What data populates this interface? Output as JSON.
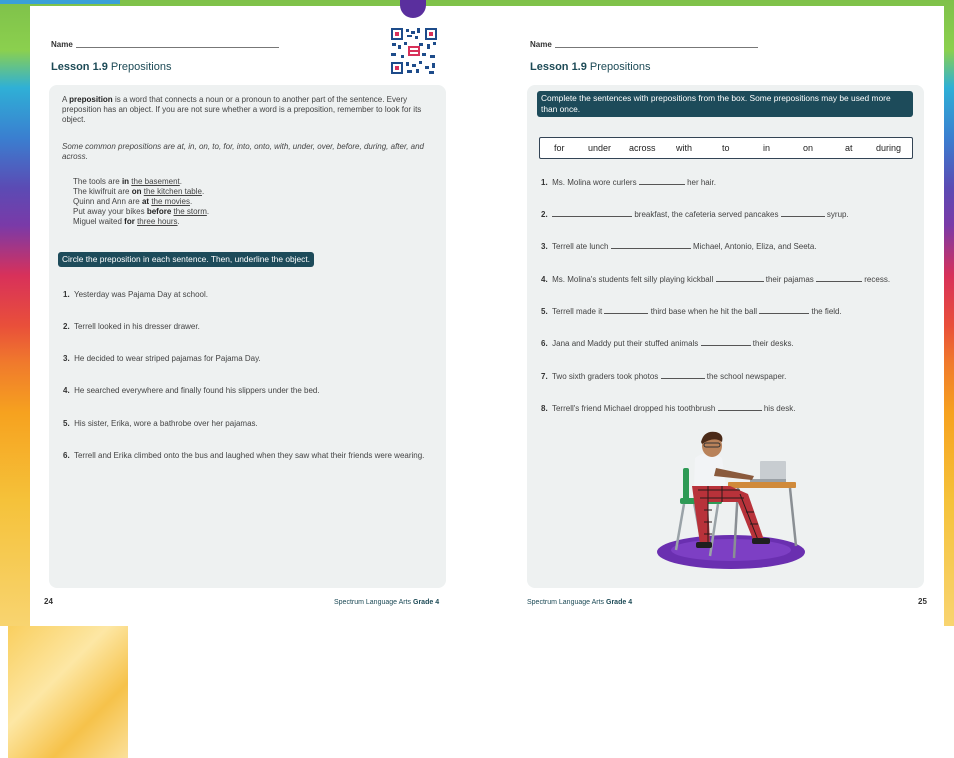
{
  "colors": {
    "banner": "#1d4b5a",
    "panel": "#eef1f1",
    "accent_purple": "#5a2f9e"
  },
  "left_page": {
    "name_label": "Name",
    "lesson_number": "Lesson 1.9",
    "lesson_title": "Prepositions",
    "intro_1": "A",
    "intro_bold": "preposition",
    "intro_2": "is a word that connects a noun or a pronoun to another part of the sentence. Every preposition has an object. If you are not sure whether a word is a preposition, remember to look for its object.",
    "common_line": "Some common prepositions are at, in, on, to, for, into, onto, with, under, over, before, during, after, and across.",
    "examples": [
      {
        "pre": "The tools are",
        "prep": "in",
        "obj": "the basement",
        "post": "."
      },
      {
        "pre": "The kiwifruit are",
        "prep": "on",
        "obj": "the kitchen table",
        "post": "."
      },
      {
        "pre": "Quinn and Ann are",
        "prep": "at",
        "obj": "the movies",
        "post": "."
      },
      {
        "pre": "Put away your bikes",
        "prep": "before",
        "obj": "the storm",
        "post": "."
      },
      {
        "pre": "Miguel waited",
        "prep": "for",
        "obj": "three hours",
        "post": "."
      }
    ],
    "instruction": "Circle the preposition in each sentence. Then, underline the object.",
    "questions": [
      {
        "num": "1.",
        "text": "Yesterday was Pajama Day at school."
      },
      {
        "num": "2.",
        "text": "Terrell looked in his dresser drawer."
      },
      {
        "num": "3.",
        "text": "He decided to wear striped pajamas for Pajama Day."
      },
      {
        "num": "4.",
        "text": "He searched everywhere and finally found his slippers under the bed."
      },
      {
        "num": "5.",
        "text": "His sister, Erika, wore a bathrobe over her pajamas."
      },
      {
        "num": "6.",
        "text": "Terrell and Erika climbed onto the bus and laughed when they saw what their friends were wearing."
      }
    ],
    "page_number": "24",
    "footer_series": "Spectrum Language Arts",
    "footer_grade": "Grade 4"
  },
  "right_page": {
    "name_label": "Name",
    "lesson_number": "Lesson 1.9",
    "lesson_title": "Prepositions",
    "instruction": "Complete the sentences with prepositions from the box. Some prepositions may be used more than once.",
    "word_box": [
      "for",
      "under",
      "across",
      "with",
      "to",
      "in",
      "on",
      "at",
      "during"
    ],
    "questions": [
      {
        "num": "1.",
        "a": "Ms. Molina wore curlers",
        "b": "her hair.",
        "c": "",
        "d": ""
      },
      {
        "num": "2.",
        "a": "",
        "b": "breakfast, the cafeteria served pancakes",
        "c": "syrup.",
        "d": ""
      },
      {
        "num": "3.",
        "a": "Terrell ate lunch",
        "b": "Michael, Antonio, Eliza, and Seeta.",
        "c": "",
        "d": ""
      },
      {
        "num": "4.",
        "a": "Ms. Molina's students felt silly playing kickball",
        "b": "their pajamas",
        "c": "recess.",
        "d": ""
      },
      {
        "num": "5.",
        "a": "Terrell made it",
        "b": "third base when he hit the ball",
        "c": "the field.",
        "d": ""
      },
      {
        "num": "6.",
        "a": "Jana and Maddy put their stuffed animals",
        "b": "their desks.",
        "c": "",
        "d": ""
      },
      {
        "num": "7.",
        "a": "Two sixth graders took photos",
        "b": "the school newspaper.",
        "c": "",
        "d": ""
      },
      {
        "num": "8.",
        "a": "Terrell's friend Michael dropped his toothbrush",
        "b": "his desk.",
        "c": "",
        "d": ""
      }
    ],
    "page_number": "25",
    "footer_series": "Spectrum Language Arts",
    "footer_grade": "Grade 4"
  }
}
